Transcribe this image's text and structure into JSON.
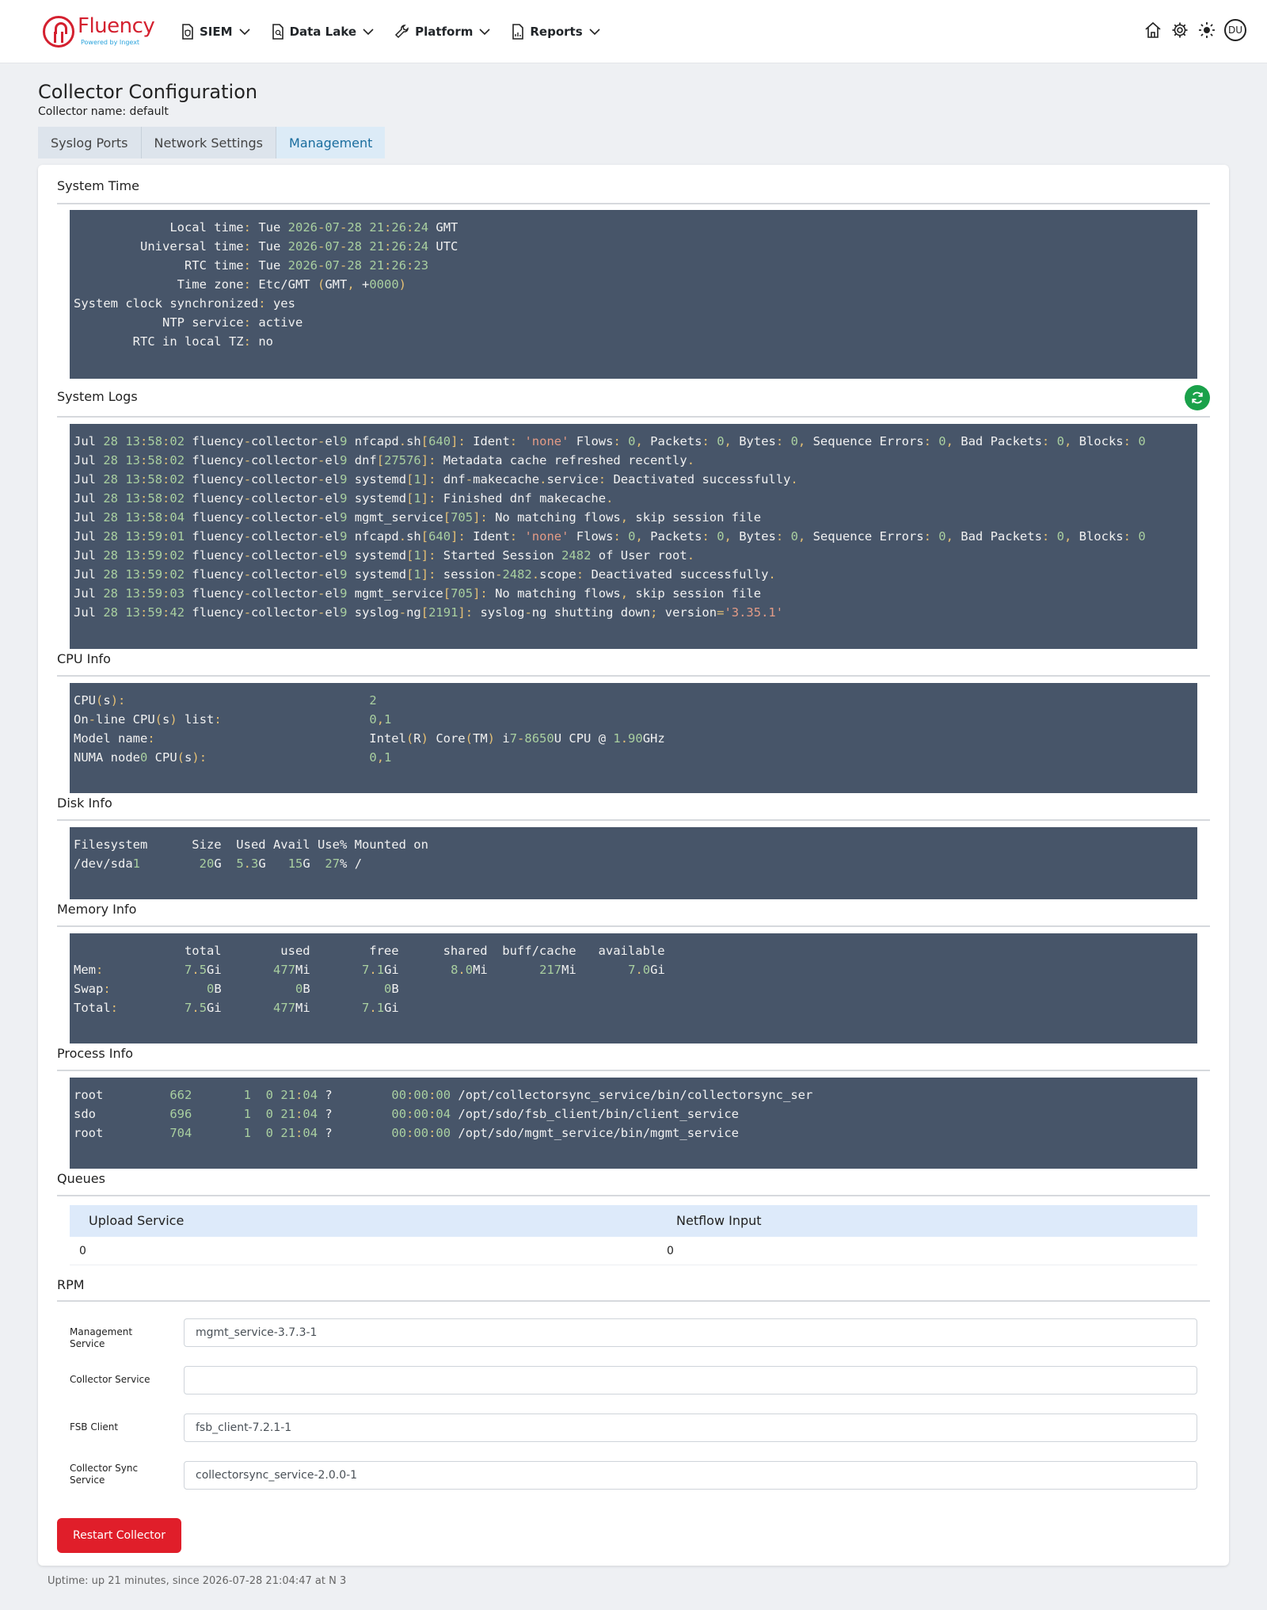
{
  "brand": {
    "name": "Fluency",
    "tagline": "Powered by Ingext"
  },
  "nav": [
    {
      "label": "SIEM",
      "icon": "document-shield-icon"
    },
    {
      "label": "Data Lake",
      "icon": "document-search-icon"
    },
    {
      "label": "Platform",
      "icon": "wrench-icon"
    },
    {
      "label": "Reports",
      "icon": "report-chart-icon"
    }
  ],
  "header": {
    "avatar_initials": "DU"
  },
  "page": {
    "title": "Collector Configuration",
    "collector_name": "Collector name: default"
  },
  "tabs": [
    {
      "label": "Syslog Ports",
      "active": false
    },
    {
      "label": "Network Settings",
      "active": false
    },
    {
      "label": "Management",
      "active": true
    }
  ],
  "sections": {
    "system_time": "System Time",
    "system_logs": "System Logs",
    "cpu_info": "CPU Info",
    "disk_info": "Disk Info",
    "memory_info": "Memory Info",
    "process_info": "Process Info",
    "queues": "Queues",
    "rpm": "RPM"
  },
  "system_time_lines": [
    "             Local time: Tue 2026-07-28 21:26:24 GMT",
    "         Universal time: Tue 2026-07-28 21:26:24 UTC",
    "               RTC time: Tue 2026-07-28 21:26:23",
    "              Time zone: Etc/GMT (GMT, +0000)",
    "System clock synchronized: yes",
    "            NTP service: active",
    "        RTC in local TZ: no"
  ],
  "system_log_lines": [
    "Jul 28 13:58:02 fluency-collector-el9 nfcapd.sh[640]: Ident: 'none' Flows: 0, Packets: 0, Bytes: 0, Sequence Errors: 0, Bad Packets: 0, Blocks: 0",
    "Jul 28 13:58:02 fluency-collector-el9 dnf[27576]: Metadata cache refreshed recently.",
    "Jul 28 13:58:02 fluency-collector-el9 systemd[1]: dnf-makecache.service: Deactivated successfully.",
    "Jul 28 13:58:02 fluency-collector-el9 systemd[1]: Finished dnf makecache.",
    "Jul 28 13:58:04 fluency-collector-el9 mgmt_service[705]: No matching flows, skip session file",
    "Jul 28 13:59:01 fluency-collector-el9 nfcapd.sh[640]: Ident: 'none' Flows: 0, Packets: 0, Bytes: 0, Sequence Errors: 0, Bad Packets: 0, Blocks: 0",
    "Jul 28 13:59:02 fluency-collector-el9 systemd[1]: Started Session 2482 of User root.",
    "Jul 28 13:59:02 fluency-collector-el9 systemd[1]: session-2482.scope: Deactivated successfully.",
    "Jul 28 13:59:03 fluency-collector-el9 mgmt_service[705]: No matching flows, skip session file",
    "Jul 28 13:59:42 fluency-collector-el9 syslog-ng[2191]: syslog-ng shutting down; version='3.35.1'"
  ],
  "cpu_lines": [
    "CPU(s):                                 2",
    "On-line CPU(s) list:                    0,1",
    "Model name:                             Intel(R) Core(TM) i7-8650U CPU @ 1.90GHz",
    "NUMA node0 CPU(s):                      0,1"
  ],
  "disk_lines": [
    "Filesystem      Size  Used Avail Use% Mounted on",
    "/dev/sda1        20G  5.3G   15G  27% /"
  ],
  "memory_lines": [
    "               total        used        free      shared  buff/cache   available",
    "Mem:           7.5Gi       477Mi       7.1Gi       8.0Mi       217Mi       7.0Gi",
    "Swap:             0B          0B          0B",
    "Total:         7.5Gi       477Mi       7.1Gi"
  ],
  "process_lines": [
    "root         662       1  0 21:04 ?        00:00:00 /opt/collectorsync_service/bin/collectorsync_ser",
    "sdo          696       1  0 21:04 ?        00:00:04 /opt/sdo/fsb_client/bin/client_service",
    "root         704       1  0 21:04 ?        00:00:00 /opt/sdo/mgmt_service/bin/mgmt_service"
  ],
  "queues": {
    "columns": [
      "Upload Service",
      "Netflow Input"
    ],
    "values": [
      "0",
      "0"
    ]
  },
  "rpm": [
    {
      "label": "Management Service",
      "value": "mgmt_service-3.7.3-1"
    },
    {
      "label": "Collector Service",
      "value": ""
    },
    {
      "label": "FSB Client",
      "value": "fsb_client-7.2.1-1"
    },
    {
      "label": "Collector Sync Service",
      "value": "collectorsync_service-2.0.0-1"
    }
  ],
  "actions": {
    "restart_label": "Restart Collector"
  },
  "footer": {
    "uptime": "Uptime: up 21 minutes, since 2026-07-28 21:04:47 at N 3"
  },
  "colors": {
    "brand_red": "#d4202f",
    "terminal_bg": "#475569",
    "refresh_green": "#1aa14a",
    "restart_red": "#e01e2a"
  }
}
